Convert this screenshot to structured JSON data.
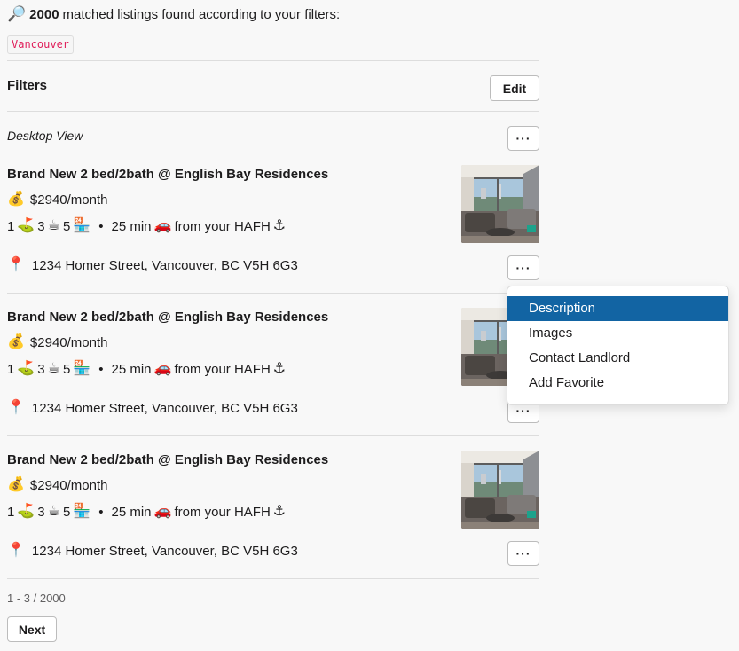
{
  "summary": {
    "icon": "magnifier-icon",
    "count": "2000",
    "text": "matched listings found according to your filters:"
  },
  "filter_tag": "Vancouver",
  "filters": {
    "title": "Filters",
    "edit_label": "Edit"
  },
  "view": {
    "label": "Desktop View",
    "menu_label": "···"
  },
  "listings": [
    {
      "title": "Brand New 2 bed/2bath @ English Bay Residences",
      "price": "$2940/month",
      "golf_count": "1",
      "coffee_count": "3",
      "transit_count": "5",
      "commute": "25 min",
      "commute_suffix": "from your HAFH",
      "address": "1234 Homer Street, Vancouver, BC V5H 6G3",
      "menu_label": "···"
    },
    {
      "title": "Brand New 2 bed/2bath @ English Bay Residences",
      "price": "$2940/month",
      "golf_count": "1",
      "coffee_count": "3",
      "transit_count": "5",
      "commute": "25 min",
      "commute_suffix": "from your HAFH",
      "address": "1234 Homer Street, Vancouver, BC V5H 6G3",
      "menu_label": "···"
    },
    {
      "title": "Brand New 2 bed/2bath @ English Bay Residences",
      "price": "$2940/month",
      "golf_count": "1",
      "coffee_count": "3",
      "transit_count": "5",
      "commute": "25 min",
      "commute_suffix": "from your HAFH",
      "address": "1234 Homer Street, Vancouver, BC V5H 6G3",
      "menu_label": "···"
    }
  ],
  "pagination": {
    "range": "1 - 3 / 2000",
    "next_label": "Next"
  },
  "dropdown": {
    "items": [
      "Description",
      "Images",
      "Contact Landlord",
      "Add Favorite"
    ],
    "active": "Description"
  },
  "colors": {
    "tag_text": "#e01e5a",
    "menu_active_bg": "#1264a3",
    "divider": "#dddddd",
    "background": "#f8f8f8"
  }
}
